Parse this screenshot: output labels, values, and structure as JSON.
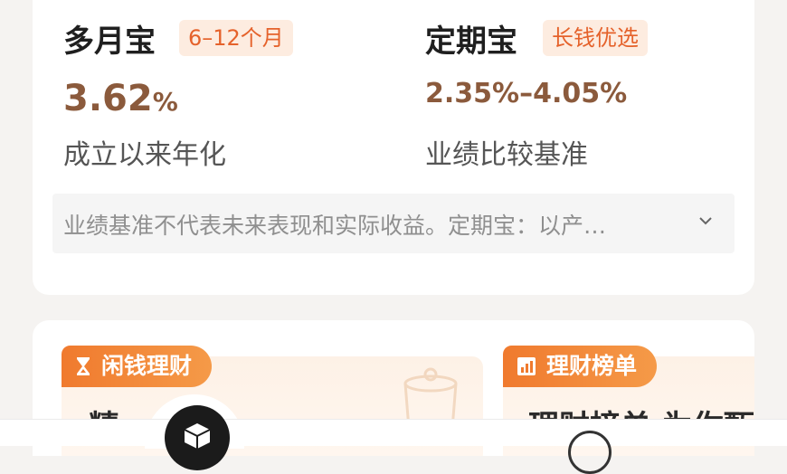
{
  "products": [
    {
      "name": "多月宝",
      "tag": "6–12个月",
      "rate_main": "3.62",
      "rate_suffix": "%",
      "rate_label": "成立以来年化"
    },
    {
      "name": "定期宝",
      "tag": "长钱优选",
      "rate_main": "2.35%–4.05%",
      "rate_suffix": "",
      "rate_label": "业绩比较基准"
    }
  ],
  "notice": {
    "text": "业绩基准不代表未来表现和实际收益。定期宝：以产…"
  },
  "sections": [
    {
      "badge": "闲钱理财",
      "title": "精…",
      "badge_icon": "hourglass-icon"
    },
    {
      "badge": "理财榜单",
      "title": "理财榜单 为你甄",
      "badge_icon": "chart-icon"
    }
  ],
  "colors": {
    "accent": "#e5622b",
    "rate": "#8b5a3c",
    "badge": "#f07a2e"
  }
}
